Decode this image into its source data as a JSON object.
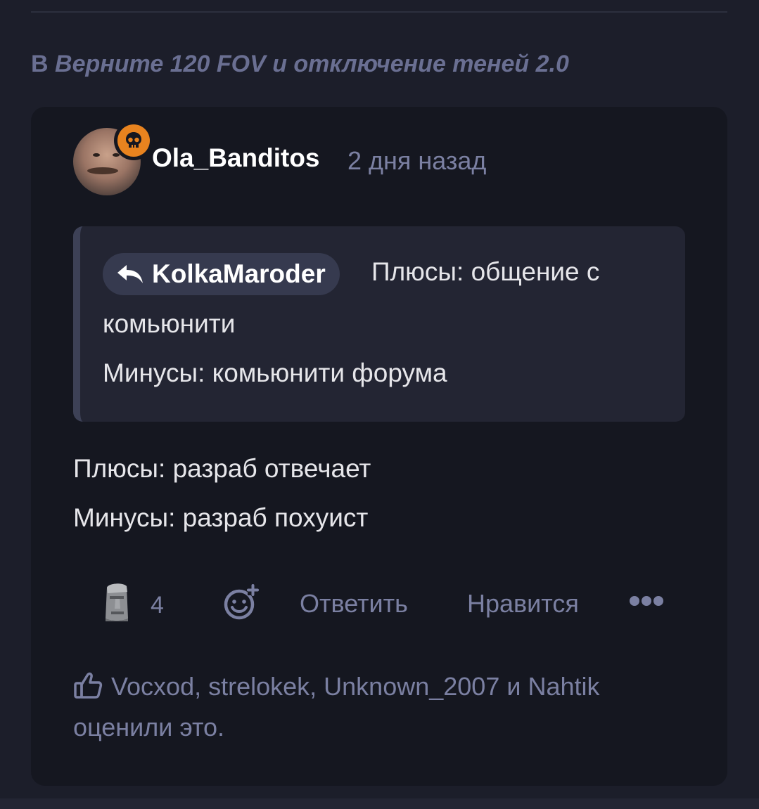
{
  "thread": {
    "prefix": "В",
    "title": "Верните 120 FOV и отключение теней 2.0"
  },
  "post": {
    "author": "Ola_Banditos",
    "badge_icon": "skull-icon",
    "badge_color": "#e8831f",
    "timestamp": "2 дня назад",
    "quote": {
      "author": "KolkaMaroder",
      "line1": "Плюсы: общение с",
      "line2": "комьюнити",
      "line3": "Минусы: комьюнити форума"
    },
    "body": {
      "line1": "Плюсы: разраб отвечает",
      "line2": "Минусы: разраб похуист"
    },
    "actions": {
      "reaction_icon": "moai-emoji",
      "reaction_count": "4",
      "add_reaction_icon": "add-emoji-icon",
      "reply_label": "Ответить",
      "like_label": "Нравится",
      "more_icon": "more-dots-icon"
    },
    "likes_summary": "Vocxod, strelokek, Unknown_2007 и Nahtik оценили это."
  },
  "colors": {
    "background": "#1c1e2a",
    "card": "#151720",
    "quote_bg": "#232533",
    "muted_text": "#7b80a2",
    "accent_badge": "#e8831f"
  }
}
